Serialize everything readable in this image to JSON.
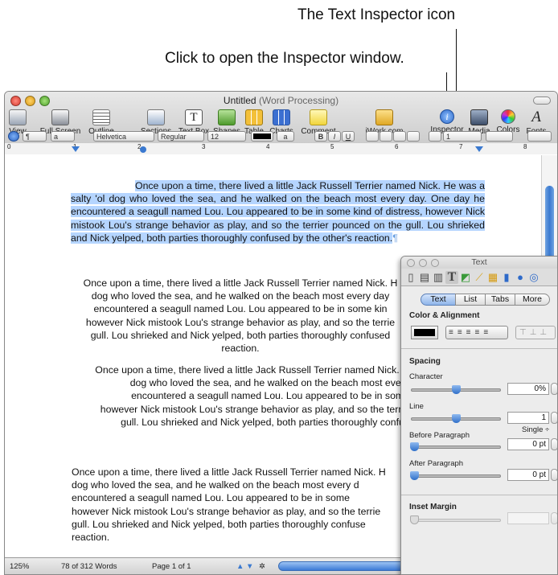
{
  "callouts": {
    "inspector_icon": "The Text Inspector icon",
    "open_inspector": "Click to open the Inspector window."
  },
  "window": {
    "title_main": "Untitled",
    "title_sub": "(Word Processing)"
  },
  "toolbar": {
    "items": [
      "View",
      "Full Screen",
      "Outline",
      "Sections",
      "Text Box",
      "Shapes",
      "Table",
      "Charts",
      "Comment",
      "iWork.com",
      "Inspector",
      "Media",
      "Colors",
      "Fonts"
    ]
  },
  "format_bar": {
    "paragraph_style": "¶",
    "char_style": "a",
    "font": "Helvetica",
    "font_style": "Regular",
    "font_size": "12",
    "line_spacing": "1",
    "text_color": "#000000"
  },
  "ruler": {
    "numbers": [
      "0",
      "1",
      "2",
      "3",
      "4",
      "5",
      "6",
      "7",
      "8"
    ]
  },
  "document": {
    "para1": "Once upon a time, there lived a little Jack Russell Terrier named Nick. He was a salty 'ol dog who loved the sea, and he walked on the beach most every day. One day he encountered a seagull named Lou. Lou appeared to be in some kind of distress, however Nick mistook Lou's strange behavior as play, and so the terrier pounced on the gull. Lou shrieked and Nick yelped, both parties thoroughly confused by the other's reaction.",
    "para1_mark": "¶",
    "para2_lines": [
      "Once upon a time, there lived a little Jack Russell Terrier named Nick. H",
      "dog who loved the sea, and he walked on the beach most every day",
      "encountered a seagull named Lou. Lou appeared to be in some kin",
      "however Nick mistook Lou's strange behavior as play, and so the terrie",
      "gull. Lou shrieked and Nick yelped, both parties thoroughly confused",
      "reaction."
    ],
    "para3_lines": [
      "Once upon a time, there lived a little Jack Russell Terrier named Nick. H",
      "dog who loved the sea, and he walked on the beach most every",
      "encountered a seagull named Lou. Lou appeared to be in some",
      "however Nick mistook Lou's strange behavior as play, and so the terrie",
      "gull. Lou shrieked and Nick yelped, both parties thoroughly confus"
    ],
    "para4_lines": [
      "Once upon a time, there lived a little Jack Russell Terrier named Nick. H",
      "dog who loved the sea, and he walked on the beach most every d",
      "encountered a seagull named Lou. Lou appeared to be in some",
      "however Nick mistook Lou's strange behavior as play, and so the terrie",
      "gull. Lou shrieked and Nick yelped, both parties thoroughly confuse",
      "reaction."
    ]
  },
  "status_bar": {
    "zoom": "125%",
    "word_count": "78 of 312 Words",
    "page": "Page 1 of 1"
  },
  "inspector": {
    "title": "Text",
    "tabs": [
      "Text",
      "List",
      "Tabs",
      "More"
    ],
    "color_alignment": "Color & Alignment",
    "spacing": "Spacing",
    "character": "Character",
    "character_value": "0%",
    "line": "Line",
    "line_value": "1",
    "line_mode": "Single ÷",
    "before_paragraph": "Before Paragraph",
    "before_value": "0 pt",
    "after_paragraph": "After Paragraph",
    "after_value": "0 pt",
    "inset_margin": "Inset Margin",
    "text_color": "#000000",
    "accent": "#3a79d0"
  }
}
